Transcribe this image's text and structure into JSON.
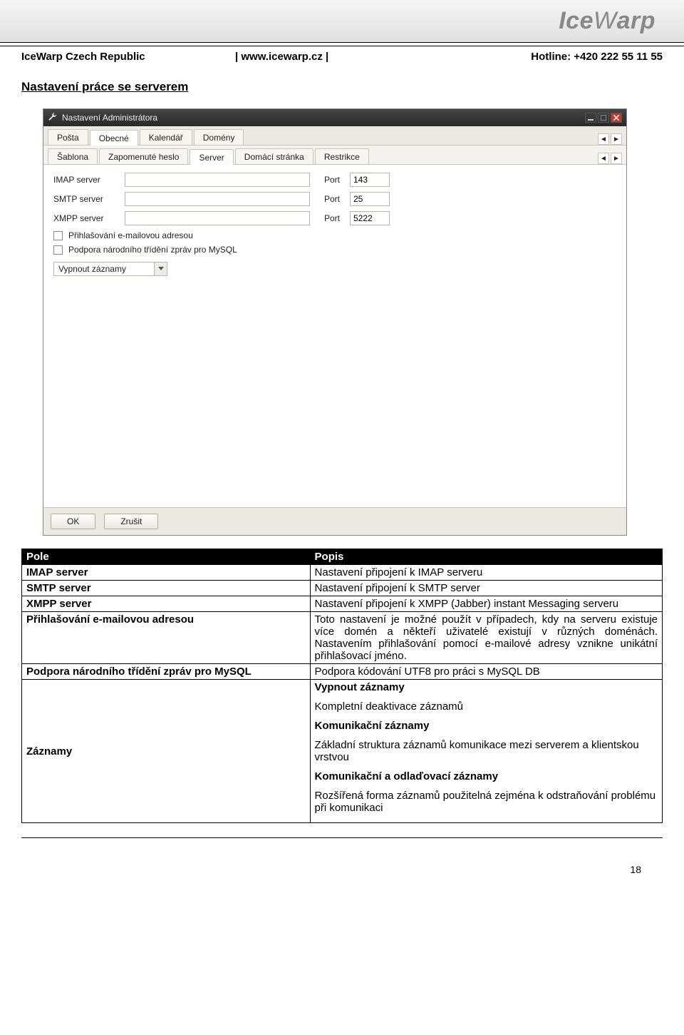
{
  "header": {
    "logo": "IceWarp",
    "company": "IceWarp Czech Republic",
    "website": "| www.icewarp.cz |",
    "hotline": "Hotline: +420 222 55 11 55"
  },
  "section_title": "Nastavení práce se serverem",
  "window": {
    "title": "Nastavení Administrátora",
    "tabs_main": [
      "Pošta",
      "Obecné",
      "Kalendář",
      "Domény"
    ],
    "tabs_main_active": 1,
    "tabs_sub": [
      "Šablona",
      "Zapomenuté heslo",
      "Server",
      "Domácí stránka",
      "Restrikce"
    ],
    "tabs_sub_active": 2,
    "rows": [
      {
        "label": "IMAP server",
        "port_label": "Port",
        "port": "143"
      },
      {
        "label": "SMTP server",
        "port_label": "Port",
        "port": "25"
      },
      {
        "label": "XMPP server",
        "port_label": "Port",
        "port": "5222"
      }
    ],
    "check1": "Přihlašování e-mailovou adresou",
    "check2": "Podpora národního třídění zpráv pro MySQL",
    "combo": "Vypnout záznamy",
    "btn_ok": "OK",
    "btn_cancel": "Zrušit"
  },
  "table": {
    "head_field": "Pole",
    "head_desc": "Popis",
    "rows": [
      {
        "f": "IMAP server",
        "d": "Nastavení připojení k IMAP serveru"
      },
      {
        "f": "SMTP server",
        "d": "Nastavení připojení k SMTP server"
      },
      {
        "f": "XMPP server",
        "d": "Nastavení připojení k XMPP (Jabber) instant Messaging serveru"
      },
      {
        "f": "Přihlašování e-mailovou adresou",
        "d": "Toto nastavení je možné použít v případech, kdy na serveru existuje více domén a někteří uživatelé existují v různých doménách. Nastavením přihlašování pomocí e-mailové adresy vznikne unikátní přihlašovací jméno."
      },
      {
        "f": "Podpora národního třídění zpráv pro MySQL",
        "d": "Podpora kódování UTF8 pro práci s MySQL DB"
      }
    ],
    "records": {
      "f": "Záznamy",
      "intro_bold": "Vypnout záznamy",
      "intro_text": "Kompletní deaktivace záznamů",
      "h1": "Komunikační záznamy",
      "t1": "Základní struktura záznamů komunikace mezi serverem a klientskou vrstvou",
      "h2": "Komunikační a odlaďovací záznamy",
      "t2": "Rozšířená forma záznamů použitelná zejména k odstraňování problému při komunikaci"
    }
  },
  "page_number": "18"
}
